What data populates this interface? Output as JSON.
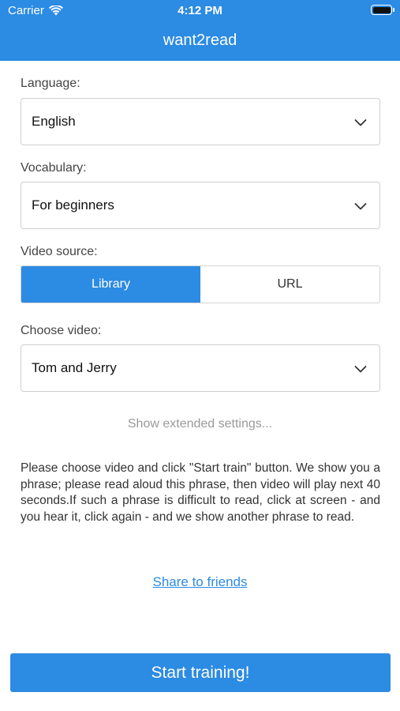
{
  "status_bar": {
    "carrier": "Carrier",
    "time": "4:12 PM",
    "wifi_icon": "wifi-icon",
    "battery_icon": "battery-icon"
  },
  "header": {
    "title": "want2read",
    "color": "#2c8be2"
  },
  "form": {
    "language": {
      "label": "Language:",
      "value": "English"
    },
    "vocabulary": {
      "label": "Vocabulary:",
      "value": "For beginners"
    },
    "video_source": {
      "label": "Video source:",
      "options": [
        "Library",
        "URL"
      ],
      "selected": "Library"
    },
    "choose_video": {
      "label": "Choose video:",
      "value": "Tom and Jerry"
    }
  },
  "extended_settings": "Show extended settings...",
  "instructions": "Please choose video and click \"Start train\" button. We show you a phrase; please read aloud this phrase, then video will play next 40 seconds.If such a phrase is difficult to read, click at screen - and you hear it, click again - and we show another phrase to read.",
  "share_link": "Share to friends",
  "start_button": "Start training!"
}
